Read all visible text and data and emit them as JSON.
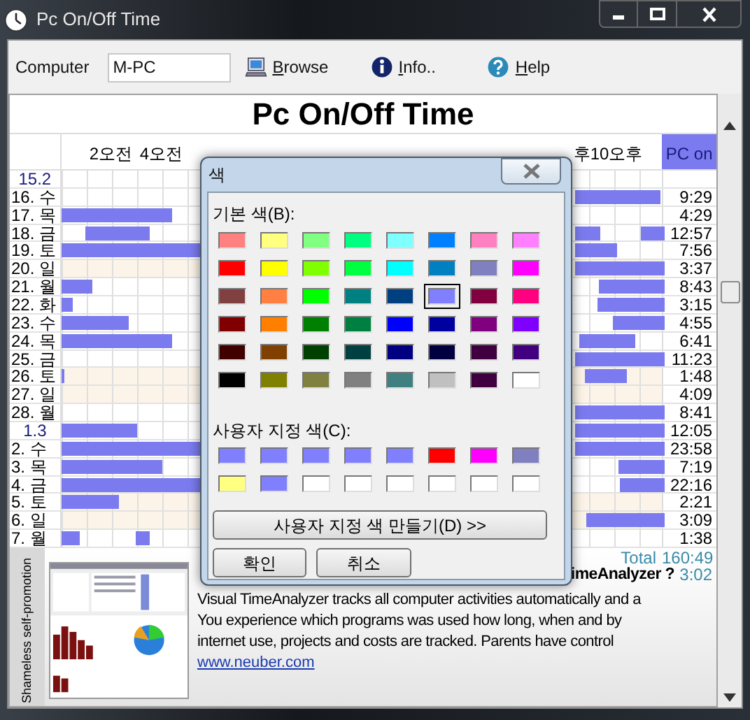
{
  "window": {
    "title": "Pc On/Off Time"
  },
  "toolbar": {
    "computer_label": "Computer",
    "computer_value": "M-PC",
    "buttons": [
      {
        "label": "Browse",
        "kind": "browse"
      },
      {
        "label": "Info..",
        "kind": "info"
      },
      {
        "label": "Help",
        "kind": "help"
      }
    ]
  },
  "report": {
    "title": "Pc On/Off Time",
    "hour_labels": [
      "2오전",
      "4오전",
      "후",
      "10오후"
    ],
    "value_header": "PC on",
    "rows": [
      {
        "date": "15.2",
        "kind": "month",
        "weekend": false
      },
      {
        "date": "16. 수",
        "kind": "day",
        "weekend": false,
        "value": "9:29"
      },
      {
        "date": "17. 목",
        "kind": "day",
        "weekend": false,
        "value": "4:29"
      },
      {
        "date": "18. 금",
        "kind": "day",
        "weekend": false,
        "value": "12:57"
      },
      {
        "date": "19. 토",
        "kind": "day",
        "weekend": false,
        "value": "7:56"
      },
      {
        "date": "20. 일",
        "kind": "day",
        "weekend": true,
        "value": "3:37"
      },
      {
        "date": "21. 월",
        "kind": "day",
        "weekend": false,
        "value": "8:43"
      },
      {
        "date": "22. 화",
        "kind": "day",
        "weekend": false,
        "value": "3:15"
      },
      {
        "date": "23. 수",
        "kind": "day",
        "weekend": false,
        "value": "4:55"
      },
      {
        "date": "24. 목",
        "kind": "day",
        "weekend": false,
        "value": "6:41"
      },
      {
        "date": "25. 금",
        "kind": "day",
        "weekend": false,
        "value": "11:23"
      },
      {
        "date": "26. 토",
        "kind": "day",
        "weekend": true,
        "value": "1:48"
      },
      {
        "date": "27. 일",
        "kind": "day",
        "weekend": true,
        "value": "4:09"
      },
      {
        "date": "28. 월",
        "kind": "day",
        "weekend": false,
        "value": "8:41"
      },
      {
        "date": "1.3",
        "kind": "month",
        "weekend": false,
        "value": "12:05"
      },
      {
        "date": "2. 수",
        "kind": "day",
        "weekend": false,
        "value": "23:58"
      },
      {
        "date": "3. 목",
        "kind": "day",
        "weekend": false,
        "value": "7:19"
      },
      {
        "date": "4. 금",
        "kind": "day",
        "weekend": false,
        "value": "22:16"
      },
      {
        "date": "5. 토",
        "kind": "day",
        "weekend": true,
        "value": "2:21"
      },
      {
        "date": "6. 일",
        "kind": "day",
        "weekend": true,
        "value": "3:09"
      },
      {
        "date": "7. 월",
        "kind": "day",
        "weekend": false,
        "value": "1:38"
      }
    ],
    "total_label": "Total",
    "total": "160:49",
    "daily_average": "3:02"
  },
  "promo": {
    "side_label": "Shameless self-promotion",
    "heading": "imeAnalyzer ?",
    "lines": [
      "Visual TimeAnalyzer tracks all computer activities automatically and a",
      "You experience which programs was used how long, when and by",
      "internet use, projects and costs are tracked. Parents have control"
    ],
    "link": "www.neuber.com"
  },
  "color_dialog": {
    "title": "색",
    "basic_label": "기본 색(B):",
    "basic_colors": [
      {
        "color": "#ff8080",
        "selected": false
      },
      {
        "color": "#ffff80",
        "selected": false
      },
      {
        "color": "#80ff80",
        "selected": false
      },
      {
        "color": "#00ff80",
        "selected": false
      },
      {
        "color": "#80ffff",
        "selected": false
      },
      {
        "color": "#0080ff",
        "selected": false
      },
      {
        "color": "#ff80c0",
        "selected": false
      },
      {
        "color": "#ff80ff",
        "selected": false
      },
      {
        "color": "#ff0000",
        "selected": false
      },
      {
        "color": "#ffff00",
        "selected": false
      },
      {
        "color": "#80ff00",
        "selected": false
      },
      {
        "color": "#00ff40",
        "selected": false
      },
      {
        "color": "#00ffff",
        "selected": false
      },
      {
        "color": "#0080c0",
        "selected": false
      },
      {
        "color": "#8080c0",
        "selected": false
      },
      {
        "color": "#ff00ff",
        "selected": false
      },
      {
        "color": "#804040",
        "selected": false
      },
      {
        "color": "#ff8040",
        "selected": false
      },
      {
        "color": "#00ff00",
        "selected": false
      },
      {
        "color": "#008080",
        "selected": false
      },
      {
        "color": "#004080",
        "selected": false
      },
      {
        "color": "#8080ff",
        "selected": true
      },
      {
        "color": "#800040",
        "selected": false
      },
      {
        "color": "#ff0080",
        "selected": false
      },
      {
        "color": "#800000",
        "selected": false
      },
      {
        "color": "#ff8000",
        "selected": false
      },
      {
        "color": "#008000",
        "selected": false
      },
      {
        "color": "#008040",
        "selected": false
      },
      {
        "color": "#0000ff",
        "selected": false
      },
      {
        "color": "#0000a0",
        "selected": false
      },
      {
        "color": "#800080",
        "selected": false
      },
      {
        "color": "#8000ff",
        "selected": false
      },
      {
        "color": "#400000",
        "selected": false
      },
      {
        "color": "#804000",
        "selected": false
      },
      {
        "color": "#004000",
        "selected": false
      },
      {
        "color": "#004040",
        "selected": false
      },
      {
        "color": "#000080",
        "selected": false
      },
      {
        "color": "#000040",
        "selected": false
      },
      {
        "color": "#400040",
        "selected": false
      },
      {
        "color": "#400080",
        "selected": false
      },
      {
        "color": "#000000",
        "selected": false
      },
      {
        "color": "#808000",
        "selected": false
      },
      {
        "color": "#808040",
        "selected": false
      },
      {
        "color": "#808080",
        "selected": false
      },
      {
        "color": "#408080",
        "selected": false
      },
      {
        "color": "#c0c0c0",
        "selected": false
      },
      {
        "color": "#400040",
        "selected": false
      },
      {
        "color": "#ffffff",
        "selected": false
      }
    ],
    "custom_label": "사용자 지정 색(C):",
    "custom_colors": [
      {
        "color": "#8080ff",
        "selected": false
      },
      {
        "color": "#8080ff",
        "selected": false
      },
      {
        "color": "#8080ff",
        "selected": false
      },
      {
        "color": "#8080ff",
        "selected": false
      },
      {
        "color": "#8080ff",
        "selected": false
      },
      {
        "color": "#ff0000",
        "selected": false
      },
      {
        "color": "#ff00ff",
        "selected": false
      },
      {
        "color": "#8080c0",
        "selected": false
      },
      {
        "color": "#ffff80",
        "selected": false
      },
      {
        "color": "#8080ff",
        "selected": false
      },
      {
        "color": "#ffffff",
        "selected": false
      },
      {
        "color": "#ffffff",
        "selected": false
      },
      {
        "color": "#ffffff",
        "selected": false
      },
      {
        "color": "#ffffff",
        "selected": false
      },
      {
        "color": "#ffffff",
        "selected": false
      },
      {
        "color": "#ffffff",
        "selected": false
      }
    ],
    "define_button": "사용자 지정 색 만들기(D) >>",
    "ok_button": "확인",
    "cancel_button": "취소"
  }
}
